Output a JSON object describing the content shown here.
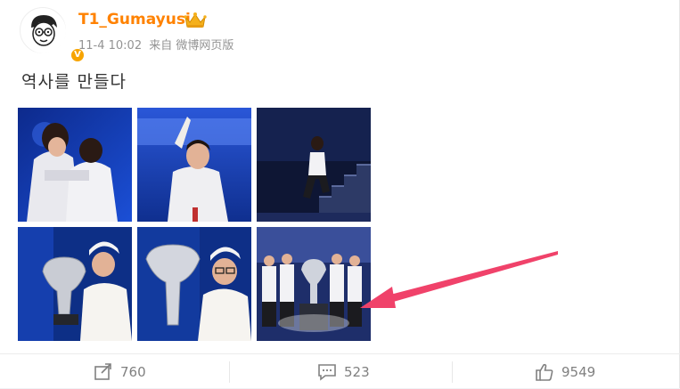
{
  "user": {
    "name": "T1_Gumayusi",
    "verified_mark": "V"
  },
  "post": {
    "date": "11-4 10:02",
    "source": "来自 微博网页版",
    "text": "역사를 만들다"
  },
  "photos": [
    {
      "name": "photo-hug"
    },
    {
      "name": "photo-stage-mic"
    },
    {
      "name": "photo-stairs"
    },
    {
      "name": "photo-trophy-1"
    },
    {
      "name": "photo-trophy-2"
    },
    {
      "name": "photo-team-trophy"
    }
  ],
  "actions": {
    "repost_count": "760",
    "comment_count": "523",
    "like_count": "9549"
  },
  "colors": {
    "username": "#ff8200",
    "arrow": "#f0426a",
    "muted": "#939393"
  }
}
